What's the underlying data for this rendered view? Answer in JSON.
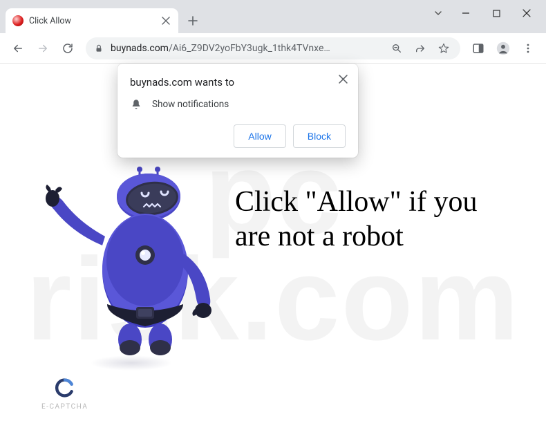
{
  "titlebar": {
    "tab_title": "Click Allow"
  },
  "toolbar": {
    "url_host": "buynads.com",
    "url_path": "/Ai6_Z9DV2yoFbY3ugk_1thk4TVnxe…"
  },
  "prompt": {
    "title": "buynads.com wants to",
    "permission": "Show notifications",
    "allow_label": "Allow",
    "block_label": "Block"
  },
  "page": {
    "headline": "Click \"Allow\" if you are not a robot",
    "captcha_label": "E-CAPTCHA"
  },
  "watermark": {
    "line1": "pc",
    "line2": "risk.com"
  }
}
